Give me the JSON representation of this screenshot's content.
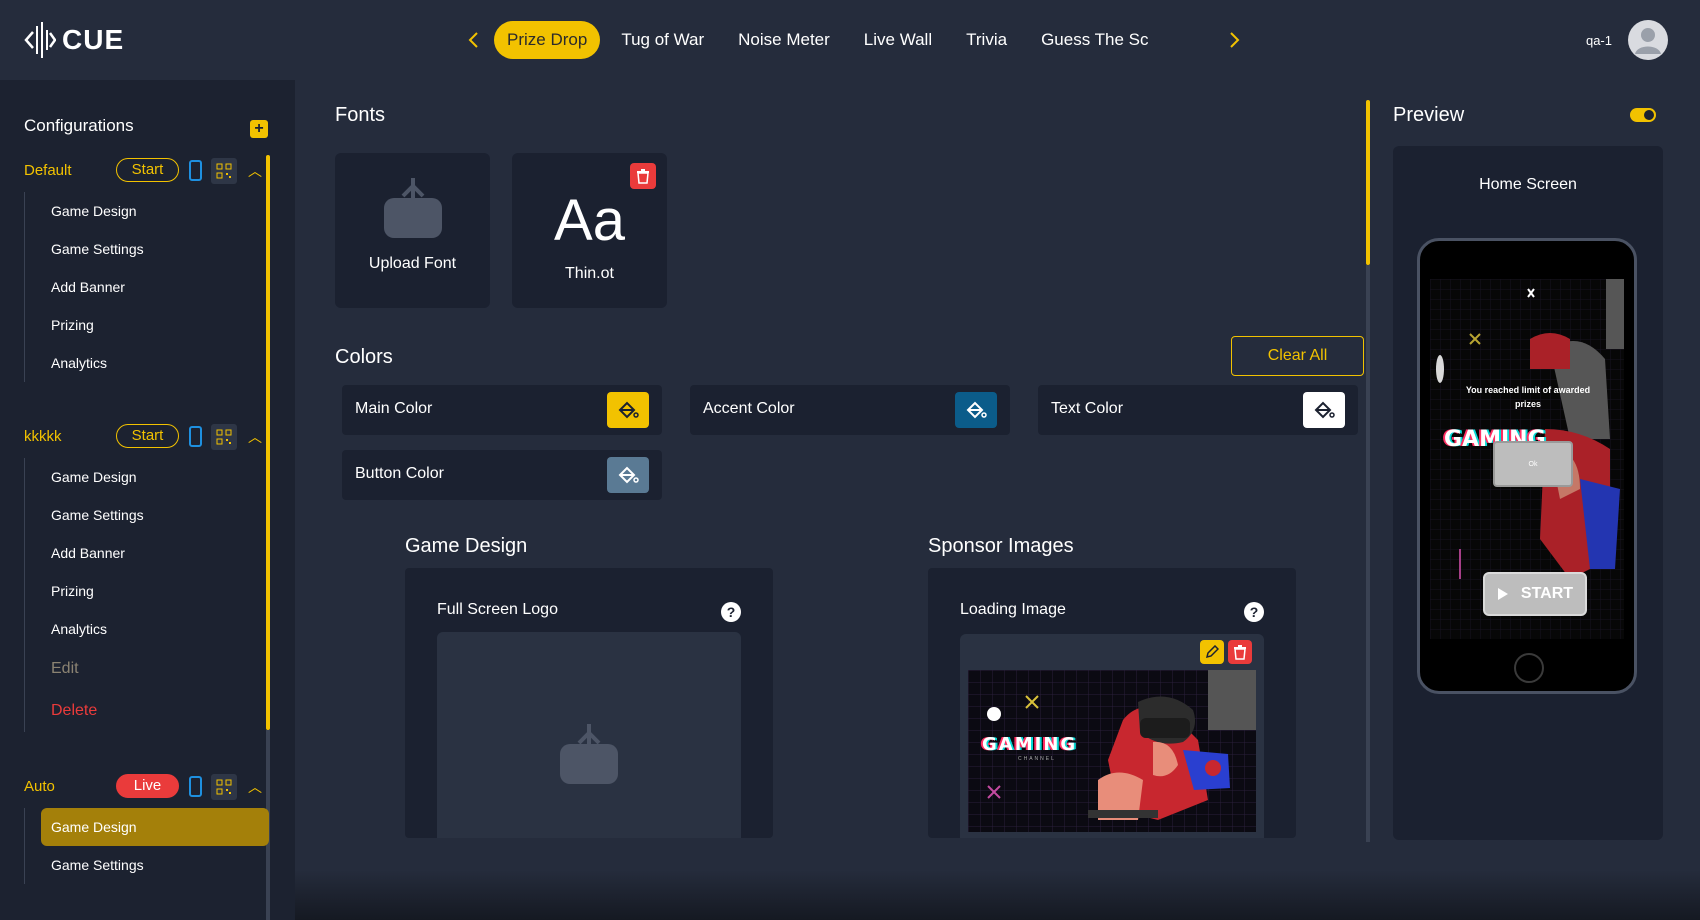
{
  "app": {
    "logo_text": "CUE"
  },
  "tabs": [
    {
      "label": "Prize Drop",
      "active": true
    },
    {
      "label": "Tug of War"
    },
    {
      "label": "Noise Meter"
    },
    {
      "label": "Live Wall"
    },
    {
      "label": "Trivia"
    },
    {
      "label": "Guess The Sc"
    }
  ],
  "user": {
    "name": "qa-1"
  },
  "sidebar": {
    "title": "Configurations",
    "configs": [
      {
        "name": "Default",
        "status": "Start",
        "items": [
          "Game Design",
          "Game Settings",
          "Add Banner",
          "Prizing",
          "Analytics"
        ]
      },
      {
        "name": "kkkkk",
        "status": "Start",
        "items": [
          "Game Design",
          "Game Settings",
          "Add Banner",
          "Prizing",
          "Analytics"
        ],
        "edit": "Edit",
        "delete": "Delete"
      },
      {
        "name": "Auto",
        "status": "Live",
        "items": [
          "Game Design",
          "Game Settings"
        ],
        "active_item": "Game Design"
      }
    ]
  },
  "fonts": {
    "title": "Fonts",
    "upload_label": "Upload Font",
    "font_preview": "Aa",
    "font_name": "Thin.ot"
  },
  "colors": {
    "title": "Colors",
    "clear_all": "Clear All",
    "items": [
      {
        "label": "Main Color",
        "swatch": "#f2c200"
      },
      {
        "label": "Accent Color",
        "swatch": "#0b5c8a"
      },
      {
        "label": "Text Color",
        "swatch": "#ffffff"
      },
      {
        "label": "Button Color",
        "swatch": "#5a7a94"
      }
    ]
  },
  "game_design": {
    "title": "Game Design",
    "logo_label": "Full Screen Logo"
  },
  "sponsor": {
    "title": "Sponsor Images",
    "loading_label": "Loading Image",
    "banner_text": "GAMING",
    "banner_sub": "CHANNEL"
  },
  "preview": {
    "title": "Preview",
    "screen_label": "Home Screen",
    "message": "You reached limit of awarded prizes",
    "ok_label": "Ok",
    "start_label": "START",
    "banner_text": "GAMING"
  }
}
